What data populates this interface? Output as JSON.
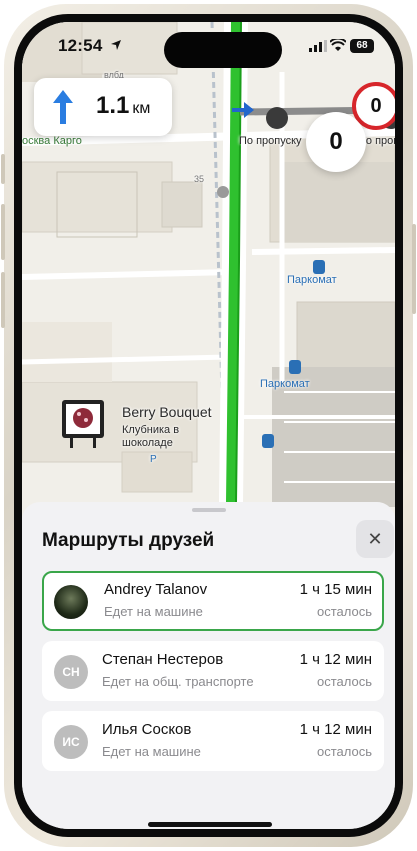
{
  "status_bar": {
    "time": "12:54",
    "battery": "68"
  },
  "navigation": {
    "distance_value": "1.1",
    "distance_unit": "км",
    "speed_limit": "0",
    "current_speed": "0"
  },
  "map": {
    "labels": {
      "building_top": "влбд",
      "cargo": "осква Карго",
      "pass1": "По пропуску",
      "pass2": "По пропуску",
      "house_35": "35",
      "parkomat1": "Паркомат",
      "parkomat2": "Паркомат",
      "poi_name": "Berry Bouquet",
      "poi_desc": "Клубника в шоколаде",
      "parking_p": "P"
    }
  },
  "sheet": {
    "title": "Маршруты друзей",
    "friends": [
      {
        "name": "Andrey Talanov",
        "status": "Едет на машине",
        "eta": "1 ч 15 мин",
        "remaining": "осталось",
        "initials": ""
      },
      {
        "name": "Степан Нестеров",
        "status": "Едет на общ. транспорте",
        "eta": "1 ч 12 мин",
        "remaining": "осталось",
        "initials": "СН"
      },
      {
        "name": "Илья Сосков",
        "status": "Едет на машине",
        "eta": "1 ч 12 мин",
        "remaining": "осталось",
        "initials": "ИС"
      }
    ]
  },
  "colors": {
    "route": "#2fc12f",
    "active_border": "#3aa64a",
    "speed_limit_ring": "#d7262b",
    "parking_blue": "#2a6fb5"
  }
}
